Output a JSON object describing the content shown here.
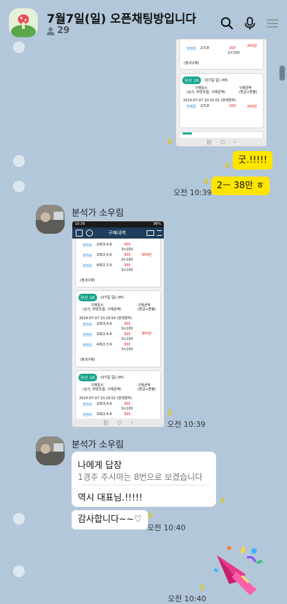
{
  "header": {
    "title": "7월7일(일) 오픈채팅방입니다",
    "member_count": "29",
    "icons": [
      "search-icon",
      "mic-icon",
      "menu-icon"
    ]
  },
  "messages": {
    "top_image": {
      "unread": "2",
      "card1": {
        "label1": "당첨일",
        "round": "2/3,8",
        "value1": "200",
        "value2": "2×100",
        "value3": "200원",
        "footer": "(정내구매)"
      },
      "card2": {
        "tag": "부산 1R",
        "date": "(07일·일) (M)",
        "col1": "구매일시",
        "col1b": "(승식, 마번조합, 구매금액)",
        "col2": "구매금액",
        "col2b": "(환급+환불)",
        "datetime": "2024-07-07 10:32:01 (현재경주)",
        "row_label": "당첨합",
        "row_round": "2/3,8",
        "row_value": "200",
        "row_value2": "200원"
      }
    },
    "msg1": {
      "text": "굿.!!!!!",
      "unread": "2"
    },
    "msg2": {
      "text": "2ㅡ 38만 ㅎ",
      "unread": "2",
      "time": "오전 10:39"
    },
    "group1": {
      "sender": "분석가 소우림",
      "phone": {
        "status_time": "10:39",
        "status_right": "98%",
        "screen_title": "구매내역",
        "rows_top": [
          {
            "label": "삼쌍승",
            "combo": "2/8/3,4,9",
            "a": "300",
            "b": "3×100"
          },
          {
            "label": "삼쌍승",
            "combo": "3/8/2,4,9",
            "a": "300",
            "b": "3×100"
          },
          {
            "label": "삼쌍승",
            "combo": "4/8/2,3,9",
            "a": "300",
            "b": "3×100"
          }
        ],
        "total1": "900원",
        "footer": "(정내구매)",
        "card2": {
          "tag": "부산 1R",
          "date": "(07일·일) (M)",
          "col1": "구매일시",
          "col1b": "(승식, 마번조합, 구매금액)",
          "col2": "구매금액",
          "col2b": "(환급+환불)",
          "datetime": "2024-07-07 10:29:54 (현재경주)",
          "rows": [
            {
              "label": "삼쌍승",
              "combo": "2/8/3,4,9",
              "a": "300",
              "b": "3×100"
            },
            {
              "label": "삼쌍승",
              "combo": "3/8/2,4,9",
              "a": "300",
              "b": "3×100"
            },
            {
              "label": "삼쌍승",
              "combo": "4/8/2,3,9",
              "a": "300",
              "b": "3×100"
            }
          ],
          "total": "900원"
        },
        "card3": {
          "tag": "부산 1R",
          "date": "(07일·일) (M)",
          "col1": "구매일시",
          "col1b": "(승식, 마번조합, 구매금액)",
          "col2": "구매금액",
          "col2b": "(환급+환불)",
          "datetime": "2024-07-07 10:29:52 (현재경주)",
          "rows": [
            {
              "label": "삼쌍승",
              "combo": "2/8/3,4,9",
              "a": "300",
              "b": "3×100"
            },
            {
              "label": "삼쌍승",
              "combo": "3/8/2,4,9",
              "a": "300",
              "b": ""
            }
          ]
        }
      },
      "unread": "2",
      "time": "오전 10:39"
    },
    "group2": {
      "sender": "분석가 소우림",
      "reply_title": "나에게 답장",
      "reply_quote": "1경주 주시마는 8번으로 보겠습니다",
      "reply_body": "역시 대표님.!!!!!",
      "reply_unread": "2",
      "msg": "감사합니다~~♡",
      "msg_unread": "2",
      "msg_time": "오전 10:40"
    },
    "sticker": {
      "name": "party-popper-sticker",
      "unread": "2",
      "time": "오전 10:40"
    }
  }
}
